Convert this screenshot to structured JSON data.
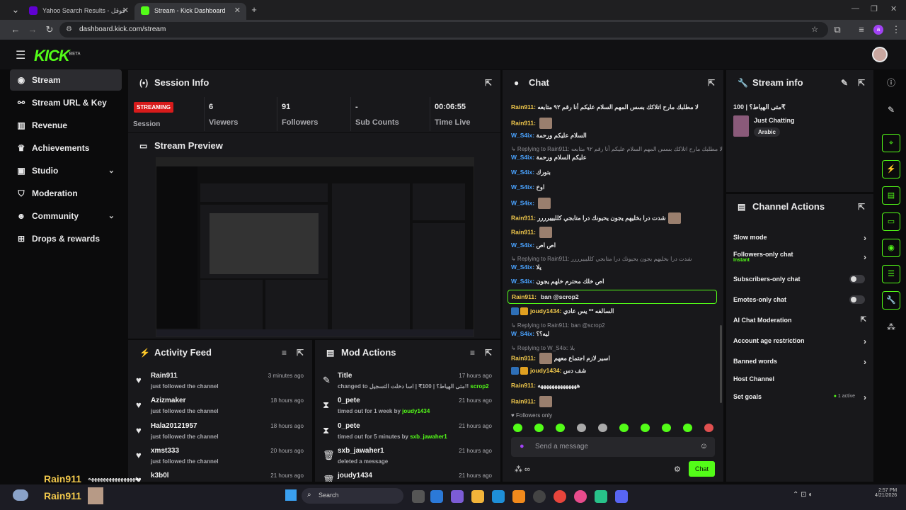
{
  "browser": {
    "tabs": [
      {
        "title": "Yahoo Search Results - فوقل",
        "active": false
      },
      {
        "title": "Stream - Kick Dashboard",
        "active": true
      }
    ],
    "url": "dashboard.kick.com/stream",
    "profile_initial": "a"
  },
  "app": {
    "logo": "KICK",
    "logo_tag": "BETA"
  },
  "sidebar": {
    "items": [
      {
        "label": "Stream",
        "icon": "broadcast-icon",
        "active": true
      },
      {
        "label": "Stream URL & Key",
        "icon": "link-icon"
      },
      {
        "label": "Revenue",
        "icon": "chart-icon"
      },
      {
        "label": "Achievements",
        "icon": "trophy-icon"
      },
      {
        "label": "Studio",
        "icon": "studio-icon",
        "expandable": true
      },
      {
        "label": "Moderation",
        "icon": "shield-icon"
      },
      {
        "label": "Community",
        "icon": "users-icon",
        "expandable": true
      },
      {
        "label": "Drops & rewards",
        "icon": "gift-icon"
      }
    ]
  },
  "session": {
    "title": "Session Info",
    "status_badge": "STREAMING",
    "session_label": "Session",
    "stats": [
      {
        "value": "6",
        "label": "Viewers"
      },
      {
        "value": "91",
        "label": "Followers"
      },
      {
        "value": "-",
        "label": "Sub Counts"
      },
      {
        "value": "00:06:55",
        "label": "Time Live"
      }
    ]
  },
  "preview": {
    "title": "Stream Preview"
  },
  "activity": {
    "title": "Activity Feed",
    "rows": [
      {
        "name": "Rain911",
        "sub": "just followed the channel",
        "time": "3 minutes ago"
      },
      {
        "name": "Azizmaker",
        "sub": "just followed the channel",
        "time": "18 hours ago"
      },
      {
        "name": "Hala20121957",
        "sub": "just followed the channel",
        "time": "18 hours ago"
      },
      {
        "name": "xmst333",
        "sub": "just followed the channel",
        "time": "20 hours ago"
      },
      {
        "name": "k3b0l",
        "sub": "",
        "time": "21 hours ago"
      }
    ]
  },
  "mod": {
    "title": "Mod Actions",
    "rows": [
      {
        "name": "Title",
        "sub_pre": "changed to ",
        "sub_value": "متى الهياط؟ | 100₹ | اسا دخلت التسجيل!!",
        "sub_user": "scrop2",
        "time": "17 hours ago"
      },
      {
        "name": "0_pete",
        "sub_pre": "timed out for 1 week by ",
        "sub_value": "",
        "sub_user": "joudy1434",
        "time": "21 hours ago"
      },
      {
        "name": "0_pete",
        "sub_pre": "timed out for 5 minutes by ",
        "sub_value": "",
        "sub_user": "sxb_jawaher1",
        "time": "21 hours ago"
      },
      {
        "name": "sxb_jawaher1",
        "sub_pre": "deleted a message",
        "sub_value": "",
        "sub_user": "",
        "time": "21 hours ago"
      },
      {
        "name": "joudy1434",
        "sub_pre": "",
        "sub_value": "",
        "sub_user": "",
        "time": "21 hours ago"
      }
    ]
  },
  "chat": {
    "title": "Chat",
    "lines": [
      {
        "user": "Rain911:",
        "text": "لا مطلبك مارح اتلاكك بسس المهم السلام عليكم أنا رقم ٩٢ متابعه",
        "kind": "u1"
      },
      {
        "user": "Rain911:",
        "text": "",
        "kind": "u1",
        "avatar": true
      },
      {
        "user": "W_S4ix:",
        "text": "السلام عليكم ورحمة",
        "kind": "u2"
      },
      {
        "reply": "Replying to Rain911: لا مطلبك مارح اتلاكك بسس المهم السلام عليكم أنا رقم ٩٢ متابعه"
      },
      {
        "user": "W_S4ix:",
        "text": "عليكم السلام ورحمة",
        "kind": "u2"
      },
      {
        "user": "W_S4ix:",
        "text": "بتورك",
        "kind": "u2"
      },
      {
        "user": "W_S4ix:",
        "text": "اوخ",
        "kind": "u2"
      },
      {
        "user": "W_S4ix:",
        "text": "",
        "kind": "u2",
        "avatar": true
      },
      {
        "user": "Rain911:",
        "text": "شدت درا بخليهم يجون يحيونك درا متابجي كلليييرررر",
        "kind": "u1",
        "avatar": true
      },
      {
        "user": "Rain911:",
        "text": "",
        "kind": "u1",
        "avatar": true
      },
      {
        "user": "W_S4ix:",
        "text": "اص اص",
        "kind": "u2"
      },
      {
        "reply": "Replying to Rain911: شدت درا بخليهم يجون يحيونك درا متابجي كلليييرررر"
      },
      {
        "user": "W_S4ix:",
        "text": "يلا",
        "kind": "u2"
      },
      {
        "user": "W_S4ix:",
        "text": "اص خلك محترم خلهم يجون",
        "kind": "u2"
      }
    ],
    "highlight": {
      "user": "Rain911:",
      "text": "ban @scrop2"
    },
    "lines2": [
      {
        "user": "joudy1434:",
        "text": "السالفه ** يس عادي",
        "kind": "u3",
        "badges": true
      },
      {
        "reply": "Replying to Rain911: ban @scrop2"
      },
      {
        "user": "W_S4ix:",
        "text": "ليه؟؟",
        "kind": "u2"
      },
      {
        "reply": "Replying to W_S4ix: بلا"
      },
      {
        "user": "Rain911:",
        "text": "اسير لازم اجتماع معهم",
        "kind": "u1",
        "avatar_before": true
      },
      {
        "user": "joudy1434:",
        "text": "شف دس",
        "kind": "u3",
        "badges": true
      },
      {
        "user": "Rain911:",
        "text": "ههههههههههههههه",
        "kind": "u1"
      },
      {
        "user": "Rain911:",
        "text": "",
        "kind": "u1",
        "avatar": true
      }
    ],
    "followers_only": "Followers only",
    "input_placeholder": "Send a message",
    "send_label": "Chat"
  },
  "stream_info": {
    "title": "Stream info",
    "stream_title": "متى الهياط؟ | 100₹",
    "category": "Just Chatting",
    "language": "Arabic"
  },
  "channel_actions": {
    "title": "Channel Actions",
    "items": [
      {
        "label": "Slow mode",
        "type": "arrow"
      },
      {
        "label": "Followers-only chat",
        "type": "arrow",
        "sub": "Instant"
      },
      {
        "label": "Subscribers-only chat",
        "type": "toggle"
      },
      {
        "label": "Emotes-only chat",
        "type": "toggle"
      },
      {
        "label": "AI Chat Moderation",
        "type": "external"
      },
      {
        "label": "Account age restriction",
        "type": "arrow"
      },
      {
        "label": "Banned words",
        "type": "arrow"
      },
      {
        "label": "Host Channel",
        "type": "none"
      },
      {
        "label": "Set goals",
        "type": "arrow",
        "sub": "1 active"
      }
    ]
  },
  "overlay": {
    "name1": "Rain911",
    "msg1": "ههههههههههههههههه",
    "name2": "Rain911"
  },
  "taskbar": {
    "search_placeholder": "Search",
    "time": "2:57 PM",
    "date": "4/21/2026"
  },
  "colors": {
    "accent": "#53fc18",
    "panel": "#18181b",
    "live": "#d81b1b"
  }
}
